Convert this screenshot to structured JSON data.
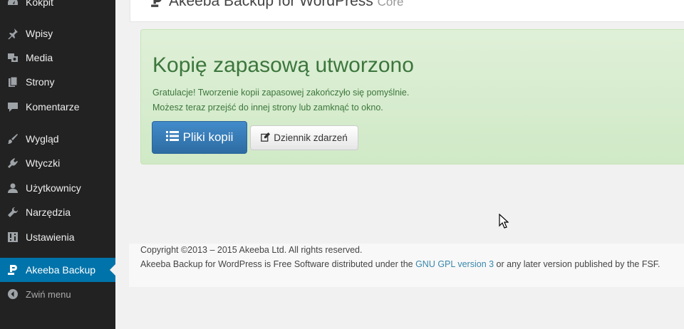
{
  "sidebar": {
    "items": [
      {
        "label": "Kokpit",
        "icon": "dashboard-icon"
      },
      {
        "label": "Wpisy",
        "icon": "pin-icon"
      },
      {
        "label": "Media",
        "icon": "media-icon"
      },
      {
        "label": "Strony",
        "icon": "pages-icon"
      },
      {
        "label": "Komentarze",
        "icon": "comment-icon"
      },
      {
        "label": "Wygląd",
        "icon": "brush-icon"
      },
      {
        "label": "Wtyczki",
        "icon": "plugin-icon"
      },
      {
        "label": "Użytkownicy",
        "icon": "user-icon"
      },
      {
        "label": "Narzędzia",
        "icon": "wrench-icon"
      },
      {
        "label": "Ustawienia",
        "icon": "settings-icon"
      },
      {
        "label": "Akeeba Backup",
        "icon": "akeeba-icon",
        "active": true
      }
    ],
    "collapse_label": "Zwiń menu",
    "active_color": "#0073aa",
    "background": "#222222"
  },
  "header": {
    "title": "Akeeba Backup for WordPress",
    "edition": "Core"
  },
  "success": {
    "heading": "Kopię zapasową utworzono",
    "line1": "Gratulacje! Tworzenie kopii zapasowej zakończyło się pomyślnie.",
    "line2": "Możesz teraz przejść do innej strony lub zamknąć to okno.",
    "primary_button": "Pliki kopii",
    "secondary_button": "Dziennik zdarzeń",
    "text_color": "#3c763d",
    "background": "#dff0d8"
  },
  "footer": {
    "copyright": "Copyright ©2013 – 2015 Akeeba Ltd. All rights reserved.",
    "license_prefix": "Akeeba Backup for WordPress is Free Software distributed under the ",
    "license_link": "GNU GPL version 3",
    "license_suffix": " or any later version published by the FSF."
  }
}
